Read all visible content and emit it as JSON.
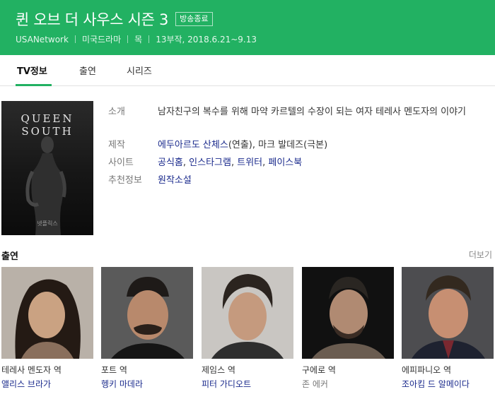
{
  "header": {
    "title": "퀸 오브 더 사우스 시즌 3",
    "badge": "방송종료",
    "network": "USANetwork",
    "genre": "미국드라마",
    "day": "목",
    "episodes": "13부작, 2018.6.21~9.13",
    "bg_color": "#22b162"
  },
  "tabs": [
    {
      "label": "TV정보",
      "active": true
    },
    {
      "label": "출연",
      "active": false
    },
    {
      "label": "시리즈",
      "active": false
    }
  ],
  "poster": {
    "title_line1": "QUEEN",
    "title_line2": "SOUTH",
    "caption": "넷플릭스"
  },
  "info": {
    "intro_label": "소개",
    "intro_text": "남자친구의 복수를 위해 마약 카르텔의 수장이 되는 여자 테레사 멘도자의 이야기",
    "production_label": "제작",
    "director": "에두아르도 산체스",
    "director_role": "(연출)",
    "writer": "마크 발데즈",
    "writer_role": "(극본)",
    "site_label": "사이트",
    "sites": [
      "공식홈",
      "인스타그램",
      "트위터",
      "페이스북"
    ],
    "recommend_label": "추천정보",
    "recommend": "원작소설"
  },
  "cast": {
    "heading": "출연",
    "more": "더보기",
    "members": [
      {
        "role": "테레사 멘도자 역",
        "name": "앨리스 브라가",
        "linked": true
      },
      {
        "role": "포트 역",
        "name": "헹키 마데라",
        "linked": true
      },
      {
        "role": "제임스 역",
        "name": "피터 가디오트",
        "linked": true
      },
      {
        "role": "구에로 역",
        "name": "존 에커",
        "linked": false
      },
      {
        "role": "에피파니오 역",
        "name": "조아킴 드 알메이다",
        "linked": true
      }
    ]
  }
}
